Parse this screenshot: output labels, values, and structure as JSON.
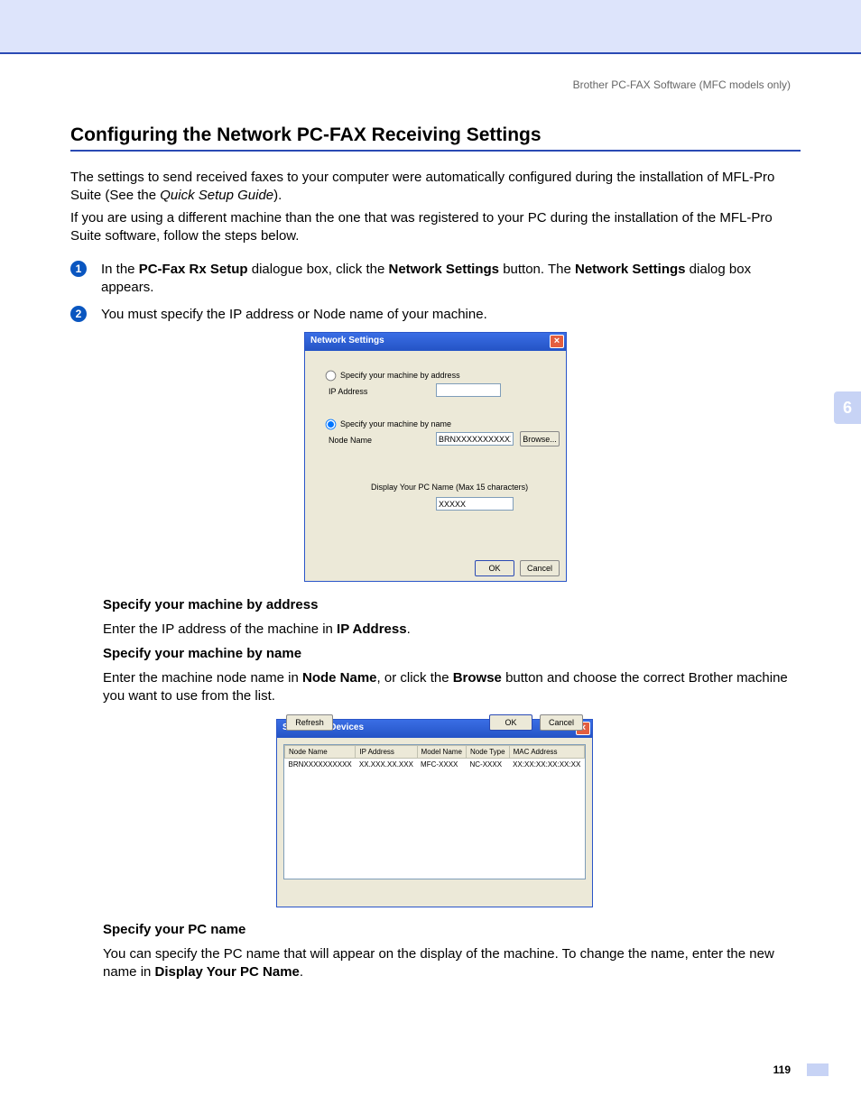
{
  "header": {
    "section": "Brother PC-FAX Software (MFC models only)"
  },
  "title": "Configuring the Network PC-FAX Receiving Settings",
  "intro1_a": "The settings to send received faxes to your computer were automatically configured during the installation of MFL-Pro Suite (See the ",
  "intro1_b": "Quick Setup Guide",
  "intro1_c": ").",
  "intro2": "If you are using a different machine than the one that was registered to your PC during the installation of the MFL-Pro Suite software, follow the steps below.",
  "steps": {
    "s1_a": "In the ",
    "s1_b": "PC-Fax Rx Setup",
    "s1_c": " dialogue box, click the ",
    "s1_d": "Network Settings",
    "s1_e": " button. The ",
    "s1_f": "Network Settings",
    "s1_g": " dialog box appears.",
    "s2": "You must specify the IP address or Node name of your machine."
  },
  "dlg1": {
    "title": "Network Settings",
    "radio_addr": "Specify your machine by address",
    "ip_label": "IP Address",
    "ip_value": "",
    "radio_name": "Specify your machine by name",
    "node_label": "Node Name",
    "node_value": "BRNXXXXXXXXXXXX",
    "browse": "Browse...",
    "pcname_label": "Display Your PC Name (Max 15 characters)",
    "pcname_value": "XXXXX",
    "ok": "OK",
    "cancel": "Cancel"
  },
  "sec1": {
    "h": "Specify your machine by address",
    "p_a": "Enter the IP address of the machine in ",
    "p_b": "IP Address",
    "p_c": "."
  },
  "sec2": {
    "h": "Specify your machine by name",
    "p_a": "Enter the machine node name in ",
    "p_b": "Node Name",
    "p_c": ", or click the ",
    "p_d": "Browse",
    "p_e": " button and choose the correct Brother machine you want to use from the list."
  },
  "dlg2": {
    "title": "Search for Devices",
    "cols": {
      "c1": "Node Name",
      "c2": "IP Address",
      "c3": "Model Name",
      "c4": "Node Type",
      "c5": "MAC Address"
    },
    "row": {
      "c1": "BRNXXXXXXXXXX",
      "c2": "XX.XXX.XX.XXX",
      "c3": "MFC-XXXX",
      "c4": "NC-XXXX",
      "c5": "XX:XX:XX:XX:XX:XX"
    },
    "refresh": "Refresh",
    "ok": "OK",
    "cancel": "Cancel"
  },
  "sec3": {
    "h": "Specify your PC name",
    "p_a": "You can specify the PC name that will appear on the display of the machine. To change the name, enter the new name in ",
    "p_b": "Display Your PC Name",
    "p_c": "."
  },
  "side_tab": "6",
  "page_num": "119",
  "badges": {
    "b1": "1",
    "b2": "2"
  }
}
